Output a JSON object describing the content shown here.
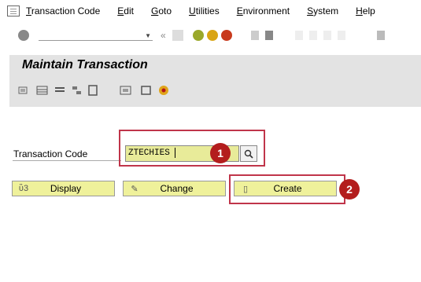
{
  "menubar": {
    "items": [
      {
        "underline": "T",
        "rest": "ransaction Code"
      },
      {
        "underline": "E",
        "rest": "dit"
      },
      {
        "underline": "G",
        "rest": "oto"
      },
      {
        "underline": "U",
        "rest": "tilities"
      },
      {
        "underline": "E",
        "rest": "nvironment"
      },
      {
        "underline": "S",
        "rest": "ystem"
      },
      {
        "underline": "H",
        "rest": "elp"
      }
    ]
  },
  "toolbar": {
    "command_field": "",
    "separator": "«"
  },
  "title": "Maintain Transaction",
  "form": {
    "label": "Transaction Code",
    "value": "ZTECHIES",
    "buttons": {
      "display": "Display",
      "change": "Change",
      "create": "Create"
    }
  },
  "annotations": {
    "step1": "1",
    "step2": "2"
  },
  "colors": {
    "field_bg": "#e8eb99",
    "button_bg": "#eff19b",
    "highlight": "#c0354a",
    "badge": "#b31d1d"
  }
}
